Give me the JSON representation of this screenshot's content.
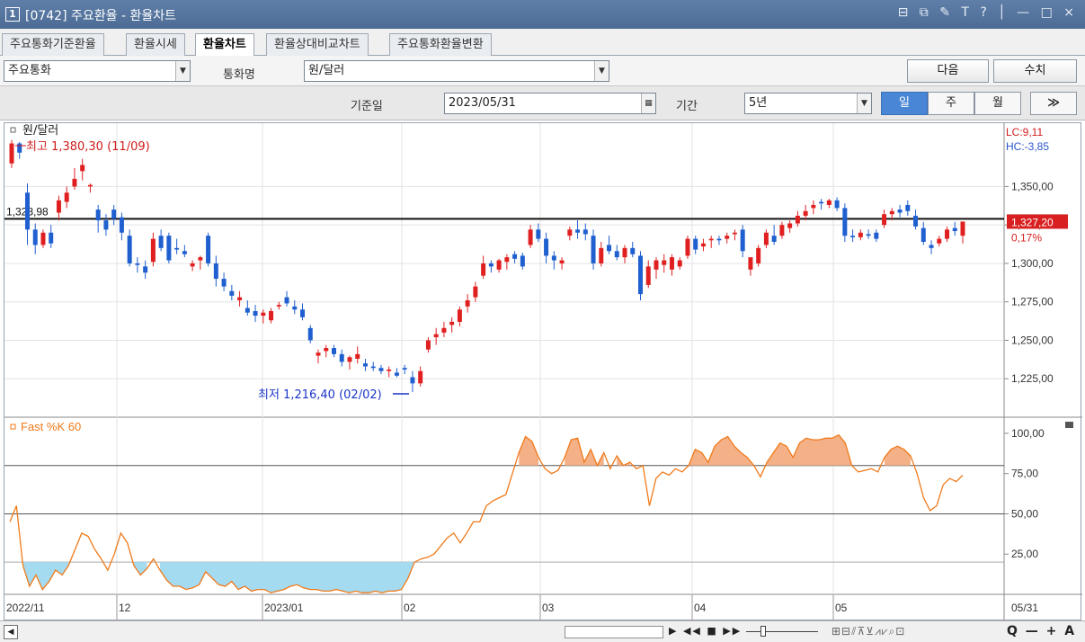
{
  "window": {
    "screen_no": "1",
    "title": "[0742] 주요환율 - 환율차트",
    "tool_icons": "⊟ ⧉ ✎ T ? │ — □ ×"
  },
  "tabs": [
    {
      "label": "주요통화기준환율"
    },
    {
      "label": "환율시세"
    },
    {
      "label": "환율차트"
    },
    {
      "label": "환율상대비교차트"
    },
    {
      "label": "주요통화환율변환"
    }
  ],
  "toolbar": {
    "category_value": "주요통화",
    "currency_label": "통화명",
    "currency_value": "원/달러",
    "next_button": "다음",
    "value_button": "수치",
    "base_date_label": "기준일",
    "base_date_value": "2023/05/31",
    "period_label": "기간",
    "period_value": "5년",
    "day_button": "일",
    "week_button": "주",
    "month_button": "월",
    "expand_button": "≫"
  },
  "chart_data": [
    {
      "type": "candlestick",
      "title": "원/달러",
      "ylim": [
        1200,
        1390
      ],
      "yticks": [
        "1,350,00",
        "1,325,00",
        "1,300,00",
        "1,275,00",
        "1,250,00",
        "1,225,00"
      ],
      "ytick_values": [
        1350,
        1325,
        1300,
        1275,
        1250,
        1225
      ],
      "high_annotation": "최고 1,380,30 (11/09)",
      "low_annotation": "최저 1,216,40 (02/02)",
      "ref_line_value": 1328.98,
      "ref_line_label": "1,328,98",
      "current_label": "1,327,20",
      "current_change": "0,17%",
      "lc_label": "LC:9,11",
      "hc_label": "HC:-3,85",
      "xticks": [
        "2022/11",
        "12",
        "2023/01",
        "02",
        "03",
        "04",
        "05",
        "05/31"
      ],
      "up_color": "#e02020",
      "down_color": "#1f5fcf",
      "candles": [
        [
          1365,
          1380.3,
          1362,
          1378
        ],
        [
          1378,
          1379,
          1368,
          1372
        ],
        [
          1346,
          1352,
          1312,
          1322
        ],
        [
          1322,
          1326,
          1306,
          1312
        ],
        [
          1312,
          1322,
          1310,
          1320
        ],
        [
          1320,
          1325,
          1310,
          1313
        ],
        [
          1333,
          1344,
          1328,
          1341
        ],
        [
          1340,
          1350,
          1336,
          1346
        ],
        [
          1350,
          1362,
          1348,
          1355
        ],
        [
          1360,
          1368,
          1354,
          1364
        ],
        [
          1350,
          1352,
          1346,
          1351
        ],
        [
          1335,
          1338,
          1320,
          1328
        ],
        [
          1328,
          1332,
          1318,
          1322
        ],
        [
          1335,
          1338,
          1325,
          1329
        ],
        [
          1330,
          1333,
          1315,
          1320
        ],
        [
          1318,
          1322,
          1298,
          1300
        ],
        [
          1300,
          1304,
          1294,
          1299
        ],
        [
          1298,
          1302,
          1290,
          1294
        ],
        [
          1301,
          1320,
          1298,
          1316
        ],
        [
          1318,
          1322,
          1308,
          1310
        ],
        [
          1318,
          1320,
          1300,
          1302
        ],
        [
          1310,
          1316,
          1306,
          1309
        ],
        [
          1308,
          1312,
          1304,
          1306
        ],
        [
          1298,
          1302,
          1295,
          1300
        ],
        [
          1302,
          1305,
          1296,
          1304
        ],
        [
          1318,
          1320,
          1298,
          1300
        ],
        [
          1300,
          1305,
          1285,
          1290
        ],
        [
          1290,
          1294,
          1282,
          1285
        ],
        [
          1282,
          1286,
          1276,
          1279
        ],
        [
          1276,
          1282,
          1272,
          1278
        ],
        [
          1271,
          1276,
          1266,
          1268
        ],
        [
          1269,
          1273,
          1262,
          1266
        ],
        [
          1266,
          1270,
          1261,
          1268
        ],
        [
          1263,
          1271,
          1261,
          1269
        ],
        [
          1272,
          1275,
          1270,
          1273
        ],
        [
          1278,
          1282,
          1272,
          1274
        ],
        [
          1272,
          1276,
          1267,
          1270
        ],
        [
          1270,
          1274,
          1263,
          1265
        ],
        [
          1258,
          1260,
          1248,
          1250
        ],
        [
          1240,
          1244,
          1235,
          1242
        ],
        [
          1243,
          1247,
          1239,
          1245
        ],
        [
          1245,
          1247,
          1239,
          1241
        ],
        [
          1241,
          1244,
          1233,
          1236
        ],
        [
          1236,
          1240,
          1231,
          1239
        ],
        [
          1238,
          1246,
          1235,
          1241
        ],
        [
          1235,
          1238,
          1230,
          1233
        ],
        [
          1233,
          1236,
          1230,
          1232
        ],
        [
          1232,
          1234,
          1228,
          1230
        ],
        [
          1230,
          1233,
          1226,
          1231
        ],
        [
          1229,
          1232,
          1226,
          1227
        ],
        [
          1232,
          1234,
          1228,
          1231
        ],
        [
          1226,
          1230,
          1216.4,
          1222
        ],
        [
          1222,
          1233,
          1220,
          1230
        ],
        [
          1244,
          1252,
          1242,
          1250
        ],
        [
          1252,
          1258,
          1247,
          1254
        ],
        [
          1255,
          1262,
          1252,
          1258
        ],
        [
          1260,
          1265,
          1255,
          1262
        ],
        [
          1262,
          1272,
          1259,
          1270
        ],
        [
          1272,
          1280,
          1268,
          1276
        ],
        [
          1278,
          1288,
          1275,
          1285
        ],
        [
          1292,
          1305,
          1290,
          1300
        ],
        [
          1300,
          1302,
          1294,
          1298
        ],
        [
          1296,
          1303,
          1294,
          1302
        ],
        [
          1301,
          1306,
          1296,
          1304
        ],
        [
          1306,
          1308,
          1300,
          1303
        ],
        [
          1305,
          1307,
          1296,
          1298
        ],
        [
          1312,
          1325,
          1310,
          1322
        ],
        [
          1322,
          1326,
          1314,
          1316
        ],
        [
          1316,
          1320,
          1300,
          1305
        ],
        [
          1305,
          1308,
          1296,
          1302
        ],
        [
          1300,
          1304,
          1296,
          1302
        ],
        [
          1318,
          1324,
          1315,
          1322
        ],
        [
          1322,
          1328,
          1316,
          1320
        ],
        [
          1322,
          1326,
          1315,
          1319
        ],
        [
          1318,
          1322,
          1296,
          1300
        ],
        [
          1300,
          1314,
          1298,
          1310
        ],
        [
          1312,
          1318,
          1306,
          1308
        ],
        [
          1308,
          1312,
          1302,
          1304
        ],
        [
          1304,
          1312,
          1300,
          1310
        ],
        [
          1310,
          1314,
          1304,
          1306
        ],
        [
          1305,
          1308,
          1276,
          1280
        ],
        [
          1286,
          1302,
          1284,
          1298
        ],
        [
          1296,
          1304,
          1290,
          1302
        ],
        [
          1299,
          1306,
          1294,
          1302
        ],
        [
          1296,
          1306,
          1292,
          1304
        ],
        [
          1298,
          1304,
          1296,
          1302
        ],
        [
          1305,
          1318,
          1303,
          1316
        ],
        [
          1316,
          1318,
          1306,
          1309
        ],
        [
          1311,
          1316,
          1308,
          1313
        ],
        [
          1315,
          1318,
          1310,
          1316
        ],
        [
          1316,
          1318,
          1312,
          1315
        ],
        [
          1316,
          1320,
          1313,
          1318
        ],
        [
          1319,
          1322,
          1315,
          1320
        ],
        [
          1322,
          1325,
          1304,
          1308
        ],
        [
          1296,
          1300,
          1292,
          1304
        ],
        [
          1300,
          1312,
          1298,
          1310
        ],
        [
          1312,
          1322,
          1310,
          1320
        ],
        [
          1318,
          1325,
          1312,
          1314
        ],
        [
          1318,
          1327,
          1316,
          1325
        ],
        [
          1323,
          1328,
          1320,
          1326
        ],
        [
          1326,
          1334,
          1324,
          1331
        ],
        [
          1331,
          1338,
          1328,
          1334
        ],
        [
          1336,
          1341,
          1332,
          1338
        ],
        [
          1340,
          1342,
          1335,
          1339
        ],
        [
          1338,
          1342,
          1336,
          1341
        ],
        [
          1341,
          1343,
          1334,
          1336
        ],
        [
          1336,
          1339,
          1314,
          1318
        ],
        [
          1318,
          1322,
          1314,
          1317
        ],
        [
          1317,
          1322,
          1315,
          1320
        ],
        [
          1319,
          1322,
          1316,
          1318
        ],
        [
          1320,
          1322,
          1314,
          1316
        ],
        [
          1325,
          1335,
          1323,
          1332
        ],
        [
          1332,
          1336,
          1328,
          1334
        ],
        [
          1335,
          1338,
          1330,
          1333
        ],
        [
          1338,
          1341,
          1331,
          1334
        ],
        [
          1331,
          1335,
          1322,
          1324
        ],
        [
          1323,
          1327,
          1312,
          1314
        ],
        [
          1312,
          1315,
          1306,
          1310
        ],
        [
          1313,
          1318,
          1311,
          1316
        ],
        [
          1316,
          1324,
          1314,
          1322
        ],
        [
          1323,
          1327,
          1318,
          1321
        ],
        [
          1318,
          1322,
          1313,
          1327.2
        ]
      ]
    },
    {
      "type": "line",
      "title": "Fast %K 60",
      "ylim": [
        0,
        110
      ],
      "yticks": [
        "100,00",
        "75,00",
        "50,00",
        "25,00"
      ],
      "ytick_values": [
        100,
        75,
        50,
        25
      ],
      "upper_band": 80,
      "lower_band": 20,
      "line_color": "#f07a1a",
      "overbought_fill": "#f4b086",
      "oversold_fill": "#a5dbf1",
      "values": [
        45,
        55,
        18,
        5,
        12,
        3,
        8,
        15,
        12,
        18,
        28,
        38,
        36,
        28,
        22,
        15,
        25,
        38,
        32,
        18,
        12,
        16,
        22,
        15,
        9,
        5,
        5,
        3,
        4,
        6,
        14,
        10,
        6,
        5,
        8,
        3,
        5,
        2,
        3,
        3,
        1,
        2,
        3,
        5,
        6,
        4,
        3,
        3,
        2,
        2,
        3,
        2,
        1,
        2,
        1,
        1,
        2,
        1,
        2,
        2,
        3,
        10,
        20,
        22,
        23,
        25,
        30,
        35,
        38,
        32,
        38,
        45,
        45,
        55,
        58,
        60,
        62,
        75,
        88,
        98,
        95,
        85,
        78,
        75,
        77,
        85,
        96,
        97,
        82,
        90,
        80,
        88,
        78,
        86,
        80,
        82,
        78,
        80,
        55,
        72,
        76,
        74,
        78,
        76,
        80,
        90,
        88,
        82,
        92,
        96,
        98,
        92,
        88,
        85,
        80,
        73,
        82,
        88,
        94,
        92,
        85,
        94,
        97,
        96,
        96,
        97,
        97,
        99,
        94,
        80,
        76,
        77,
        78,
        76,
        85,
        90,
        92,
        90,
        86,
        75,
        60,
        52,
        55,
        68,
        72,
        70,
        74
      ]
    }
  ],
  "scroll_icons": "▶ ◀◀ ■ ▶▶",
  "zoom_controls": "Q — + A"
}
